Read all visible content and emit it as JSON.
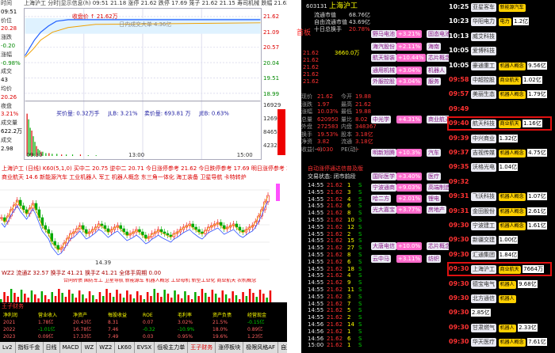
{
  "left_labels": [
    {
      "text": "时间",
      "color": "#333"
    },
    {
      "text": "09:51",
      "color": "#000"
    },
    {
      "text": "价位",
      "color": "#333"
    },
    {
      "text": "20.28",
      "color": "#d00"
    },
    {
      "text": "涨跌",
      "color": "#333"
    },
    {
      "text": "-0.20",
      "color": "#080"
    },
    {
      "text": "涨幅",
      "color": "#333"
    },
    {
      "text": "-0.98%",
      "color": "#080"
    },
    {
      "text": "成交",
      "color": "#333"
    },
    {
      "text": "43",
      "color": "#000"
    },
    {
      "text": "均价",
      "color": "#333"
    },
    {
      "text": "20.26",
      "color": "#d00"
    },
    {
      "text": "夜盘",
      "color": "#333"
    },
    {
      "text": "3.21%",
      "color": "#d00"
    },
    {
      "text": "成交量",
      "color": "#333"
    },
    {
      "text": "622.2万",
      "color": "#000"
    },
    {
      "text": "成交",
      "color": "#333"
    },
    {
      "text": "2.98",
      "color": "#000"
    }
  ],
  "chart_header": "上海沪工 分时|显示信息(h) 09:51 21.18 涨停 21.62 跌停 17.69 笼子 21.62 21.15 寿司机械 跌幅 21.62 10.03%",
  "intraday": {
    "price_labels": [
      "21.62",
      "21.09",
      "20.57",
      "20.04",
      "19.51",
      "18.99"
    ],
    "pct_labels": [
      "10.03%",
      "6.00%",
      "3.00%",
      "0.00%",
      "-3.00%",
      "-6.00%"
    ],
    "vol_labels": [
      "16929",
      "12697",
      "8465",
      "4232"
    ],
    "big_order_label": "买价量: 0.32万手",
    "jlb_label": "JLB: 3.21%",
    "buy_vol_label": "卖价量: 693.81 万",
    "jeb_label": "JEB: 0.63%",
    "time_labels": [
      "09:30",
      "13:00",
      "15:00"
    ],
    "first_label": "09:30",
    "legend": "日内成交大单 4.36亿",
    "callout": "收盘价 ↑ 21.62万"
  },
  "quote": {
    "code": "603131",
    "name": "上海沪工",
    "first_board": "首板",
    "sell": [
      "21.62",
      "21.62",
      "21.62",
      "21.62",
      "21.62"
    ],
    "buy": [
      "21.62",
      "21.61",
      "21.60",
      "21.59",
      "21.58"
    ],
    "buy_vol": [
      "3660.0万",
      "",
      "",
      "",
      ""
    ],
    "stats": [
      {
        "k": "现价",
        "v": "21.62",
        "k2": "今开",
        "v2": "19.88"
      },
      {
        "k": "涨跌",
        "v": "1.97",
        "k2": "最高",
        "v2": "21.62"
      },
      {
        "k": "涨幅",
        "v": "10.03%",
        "k2": "最低",
        "v2": "19.88"
      },
      {
        "k": "总量",
        "v": "620950",
        "k2": "量比",
        "v2": "8.02"
      },
      {
        "k": "外盘",
        "v": "272583",
        "k2": "内盘",
        "v2": "348367"
      },
      {
        "k": "换手",
        "v": "19.53%",
        "k2": "股本",
        "v2": "3.18亿"
      },
      {
        "k": "净资",
        "v": "3.82",
        "k2": "流通",
        "v2": "3.18亿"
      },
      {
        "k": "收益(一)",
        "v": "0.030",
        "k2": "PE(动)",
        "v2": "--"
      }
    ],
    "top_info": [
      "流通市值",
      "自由流通市值",
      "十日总换手"
    ],
    "top_vals": [
      "68.76亿",
      "43.69亿",
      "20.78%"
    ]
  },
  "kline": {
    "header": "上海沪工 (日线) K60(5,1,0) 买中二 20.75 逆中二 20.71 今日涨停参考 21.62 今日跌停参考 17.69 明日涨停参考 23.78",
    "sub": "商业航天 14.6 新能源汽车 工业机器人 军工 机器人概念 东三角一体化 海工装备 卫星导航 卡特转炉",
    "high_label": "24.50",
    "low_label": "14.39",
    "right_marks": [
      "21.62",
      "18.99",
      "17.69"
    ]
  },
  "vol_header": "WZ2 流通Z 32.57 换手Z 41.21 换手Z 41.21 全体手周期 0.00 ",
  "vol_tags": "合同转债 国防军工 卫星导航 新能源车 机器人概念 工业母机 新型工业化 商业航天 农机概念",
  "wang_title": "王子财务",
  "finance_rows": [
    [
      "净利润",
      "营业收入",
      "净资产",
      "每股收益",
      "ROE",
      "毛利率",
      "资产负债",
      "经营现金"
    ],
    [
      "2021",
      "1.78亿",
      "20.43亿",
      "8.31",
      "0.07",
      "3.02%",
      "21.5%",
      "-0.15亿"
    ],
    [
      "2022",
      "-1.01亿",
      "16.78亿",
      "7.46",
      "-0.32",
      "-10.9%",
      "18.0%",
      "0.89亿"
    ],
    [
      "2023",
      "0.09亿",
      "17.33亿",
      "7.49",
      "0.03",
      "0.95%",
      "19.6%",
      "1.23亿"
    ]
  ],
  "bottom_tabs": [
    "Lv2",
    "指标千金",
    "日线",
    "MACD",
    "WZ",
    "WZ2",
    "LK60",
    "EVSX",
    "低吸主力单",
    "王子财务",
    "涨停板块",
    "极限风格AF",
    "自选股",
    "成交",
    "资金",
    "日线",
    "K线",
    "上"
  ],
  "trade": {
    "header": "自动涨停通达信普及版",
    "header2": "交易状态: 闭市前段",
    "time": "14:55",
    "rows": [
      {
        "t": "14:55",
        "p": "21.62",
        "v": "1",
        "d": "S"
      },
      {
        "t": "14:55",
        "p": "21.62",
        "v": "3",
        "d": "S"
      },
      {
        "t": "14:55",
        "p": "21.62",
        "v": "4",
        "d": "S"
      },
      {
        "t": "14:55",
        "p": "21.62",
        "v": "6",
        "d": "S"
      },
      {
        "t": "14:55",
        "p": "21.62",
        "v": "8",
        "d": "S"
      },
      {
        "t": "14:55",
        "p": "21.62",
        "v": "10",
        "d": "S"
      },
      {
        "t": "14:55",
        "p": "21.62",
        "v": "12",
        "d": "S"
      },
      {
        "t": "14:55",
        "p": "21.62",
        "v": "2",
        "d": "S"
      },
      {
        "t": "14:55",
        "p": "21.62",
        "v": "15",
        "d": "S"
      },
      {
        "t": "14:55",
        "p": "21.62",
        "v": "27",
        "d": "S"
      },
      {
        "t": "14:55",
        "p": "21.62",
        "v": "8",
        "d": "S"
      },
      {
        "t": "14:55",
        "p": "21.62",
        "v": "6",
        "d": "S"
      },
      {
        "t": "14:55",
        "p": "21.62",
        "v": "18",
        "d": "S"
      },
      {
        "t": "14:55",
        "p": "21.62",
        "v": "4",
        "d": "S"
      },
      {
        "t": "14:55",
        "p": "21.62",
        "v": "9",
        "d": "S"
      },
      {
        "t": "14:55",
        "p": "21.62",
        "v": "11",
        "d": "S"
      },
      {
        "t": "14:55",
        "p": "21.62",
        "v": "3",
        "d": "S"
      },
      {
        "t": "14:55",
        "p": "21.62",
        "v": "7",
        "d": "S"
      },
      {
        "t": "14:55",
        "p": "21.62",
        "v": "5",
        "d": "S"
      },
      {
        "t": "14:55",
        "p": "21.62",
        "v": "2",
        "d": "S"
      },
      {
        "t": "14:56",
        "p": "21.62",
        "v": "14",
        "d": "S"
      },
      {
        "t": "14:56",
        "p": "21.62",
        "v": "1",
        "d": "S"
      },
      {
        "t": "14:56",
        "p": "21.62",
        "v": "6",
        "d": "S"
      },
      {
        "t": "15:00",
        "p": "21.62",
        "v": "1",
        "d": "S"
      }
    ]
  },
  "tags": [
    {
      "name": "野马电池",
      "pct": "+3.21%",
      "sub": "固态电池"
    },
    {
      "name": "海汽股份",
      "pct": "+2.11%",
      "sub": "海南"
    },
    {
      "name": "航天智装",
      "pct": "+10.44%",
      "sub": "芯片概念"
    },
    {
      "name": "通用机械",
      "pct": "+3.04%",
      "sub": "机器人"
    },
    {
      "name": "外服控股",
      "pct": "+3.04%",
      "sub": "服务"
    },
    {
      "name": "中光学",
      "pct": "+4.31%",
      "sub": "商业航天"
    },
    {
      "name": "明新旭腾",
      "pct": "+10.3%",
      "sub": "汽车"
    },
    {
      "name": "国际医学",
      "pct": "+3.40%",
      "sub": "医疗"
    },
    {
      "name": "宁波通商",
      "pct": "+9.03%",
      "sub": "高端制造"
    },
    {
      "name": "哈二方",
      "pct": "+2.01%",
      "sub": "锂电"
    },
    {
      "name": "光大嘉宝",
      "pct": "+3.77%",
      "sub": "房地产"
    },
    {
      "name": "大唐电信",
      "pct": "+10.0%",
      "sub": "芯片概念"
    },
    {
      "name": "云中马",
      "pct": "+3.11%",
      "sub": "纺织"
    }
  ],
  "news": [
    {
      "time": "10:25",
      "name": "亚星客车",
      "badge": "新能源汽车",
      "cap": ""
    },
    {
      "time": "10:23",
      "name": "华阳电力",
      "badge": "电力",
      "cap": "1.2亿"
    },
    {
      "time": "10:13",
      "name": "威艾科技",
      "badge": "",
      "cap": ""
    },
    {
      "time": "10:05",
      "name": "爱博科技",
      "badge": "",
      "cap": ""
    },
    {
      "time": "10:05",
      "name": "豪通重工",
      "badge": "机器人概念",
      "cap": "9.56亿"
    },
    {
      "time": "09:58",
      "name": "中超控股",
      "badge": "商业航天",
      "cap": "1.02亿"
    },
    {
      "time": "09:57",
      "name": "美丽生态",
      "badge": "机器人概念",
      "cap": "1.79亿"
    },
    {
      "time": "09:49",
      "name": "",
      "badge": "",
      "cap": ""
    },
    {
      "time": "09:40",
      "name": "航天科技",
      "badge": "商业航天",
      "cap": "1.16亿"
    },
    {
      "time": "09:39",
      "name": "中兴商业",
      "badge": "",
      "cap": "1.32亿"
    },
    {
      "time": "09:37",
      "name": "吉视传媒",
      "badge": "机器人概念",
      "cap": "4.75亿"
    },
    {
      "time": "09:35",
      "name": "沃格光电",
      "badge": "",
      "cap": "1.04亿"
    },
    {
      "time": "09:32",
      "name": "",
      "badge": "",
      "cap": ""
    },
    {
      "time": "09:31",
      "name": "飞沃科技",
      "badge": "机器人概念",
      "cap": "1.07亿"
    },
    {
      "time": "09:31",
      "name": "金田股份",
      "badge": "机器人概念",
      "cap": "2.61亿"
    },
    {
      "time": "09:30",
      "name": "宁波建工",
      "badge": "机器人概念",
      "cap": "1.61亿"
    },
    {
      "time": "09:30",
      "name": "新疆交建",
      "badge": "",
      "cap": "1.00亿"
    },
    {
      "time": "09:30",
      "name": "汇通集团",
      "badge": "",
      "cap": "1.84亿"
    },
    {
      "time": "09:30",
      "name": "上海沪工",
      "badge": "商业航天",
      "cap": "7664万"
    },
    {
      "time": "09:30",
      "name": "德宝电气",
      "badge": "机器人",
      "cap": "9.68亿"
    },
    {
      "time": "09:30",
      "name": "北方通信",
      "badge": "机器人",
      "cap": ""
    },
    {
      "time": "09:30",
      "name": "",
      "badge": "",
      "cap": "2.85亿"
    },
    {
      "time": "09:30",
      "name": "甘肃燃气",
      "badge": "机器人",
      "cap": "2.33亿"
    },
    {
      "time": "09:30",
      "name": "华天医疗",
      "badge": "机器人概念",
      "cap": "7.61亿"
    }
  ],
  "colors": {
    "up": "#ff3232",
    "down": "#00d000",
    "tag_pink": "#ff6ccc",
    "badge_yellow": "#ffd000",
    "highlight": "#e01010"
  }
}
